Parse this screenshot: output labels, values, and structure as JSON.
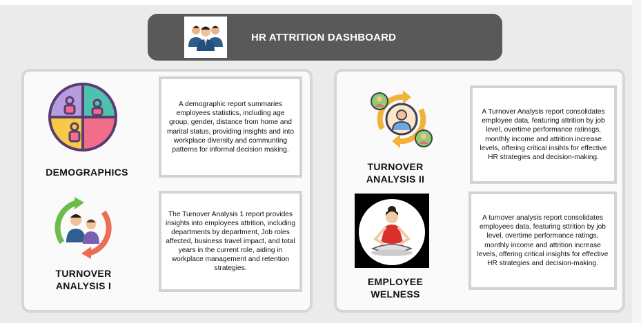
{
  "header": {
    "title": "HR ATTRITION DASHBOARD",
    "logo_icon": "team-people-icon"
  },
  "cards": {
    "demographics": {
      "title": "DEMOGRAPHICS",
      "description": "A demographic report summaries employees statistics, including age group, gender, distance from home and marital status, providing insights and into workplace diversity and communting patterns for informal decision making.",
      "icon": "pie-chart-people-icon"
    },
    "turnover1": {
      "title_line1": "TURNOVER",
      "title_line2": "ANALYSIS I",
      "description": "The Turnover Analysis 1 report provides insights into employees attrition, including departments by department, Job roles affected, business travel impact, and total years in the current role, aiding in workplace management and retention strategies.",
      "icon": "employee-cycle-icon"
    },
    "turnover2": {
      "title_line1": "TURNOVER",
      "title_line2": "ANALYSIS II",
      "description": "A Turnover Analysis report consolidates employee data, featuring attrition by job level, overtime performance ratinsgs, monthly income and attrition increase levels, offering critical insihts for effective HR strategies and decision-making.",
      "icon": "people-rotation-icon"
    },
    "wellness": {
      "title_line1": "EMPLOYEE",
      "title_line2": "WELNESS",
      "description": "A turnover analysis report consolidates employees data, featuring sttrition by job level, overtime performance ratings, monthly income and attrition increase levels, offering critical insights for effective HR strategies and decision-making.",
      "icon": "meditation-icon"
    }
  },
  "colors": {
    "header_bg": "#595959",
    "panel_border": "#d6d6d6",
    "page_bg": "#ebebeb"
  }
}
